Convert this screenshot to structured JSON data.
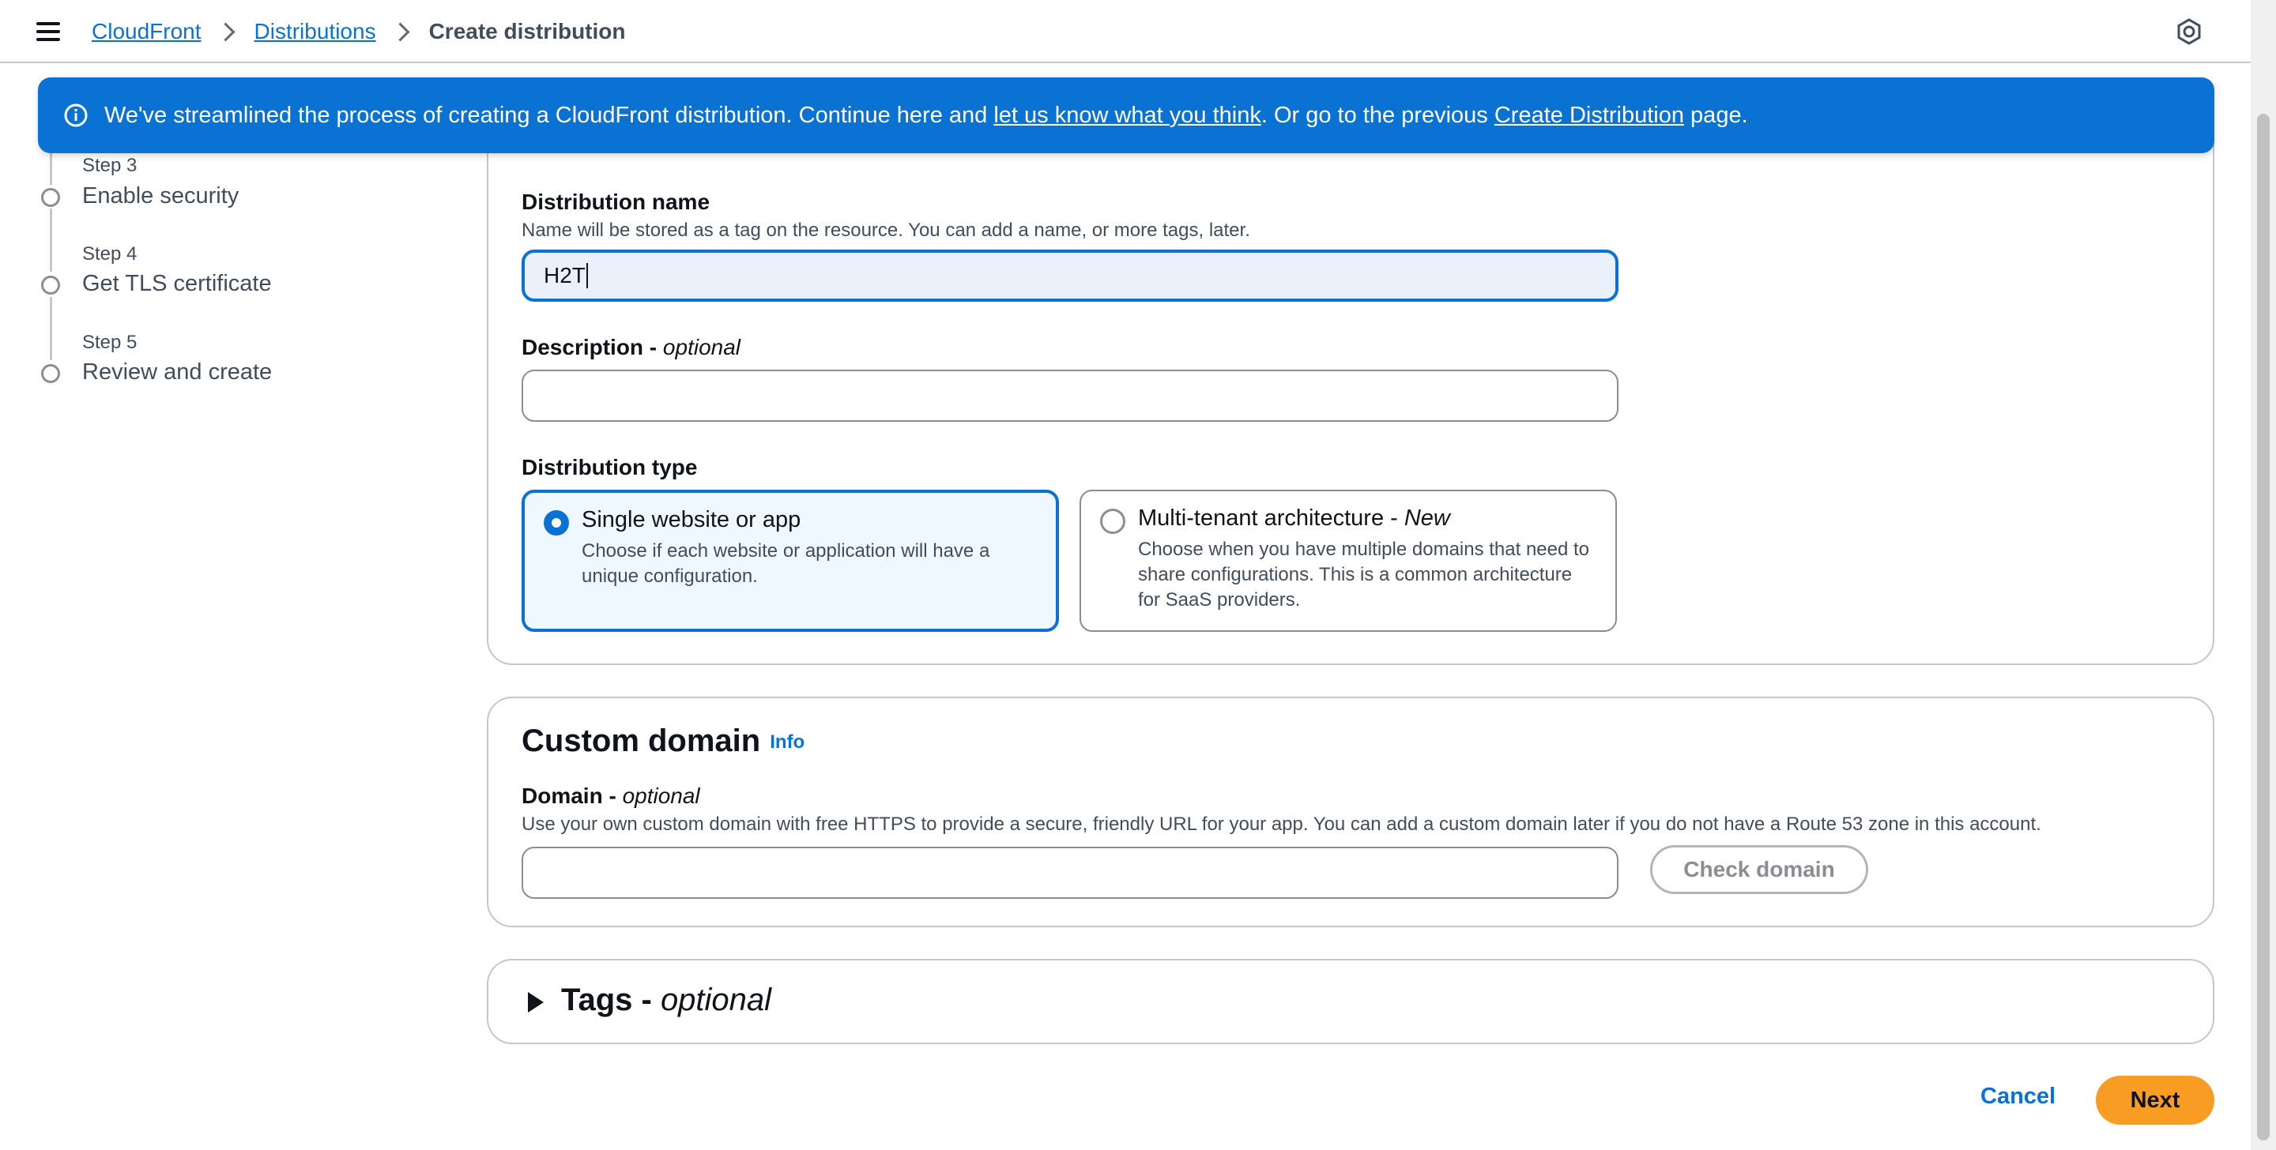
{
  "breadcrumb": {
    "home": "CloudFront",
    "distributions": "Distributions",
    "current": "Create distribution"
  },
  "banner": {
    "text1": "We've streamlined the process of creating a CloudFront distribution. Continue here and ",
    "link1": "let us know what you think",
    "text2": ". Or go to the previous ",
    "link2": "Create Distribution",
    "text3": " page."
  },
  "steps": [
    {
      "num": "Step 3",
      "label": "Enable security"
    },
    {
      "num": "Step 4",
      "label": "Get TLS certificate"
    },
    {
      "num": "Step 5",
      "label": "Review and create"
    }
  ],
  "distribution_options": {
    "name_label": "Distribution name",
    "name_desc": "Name will be stored as a tag on the resource. You can add a name, or more tags, later.",
    "name_value": "H2T",
    "description_label": "Description - ",
    "description_optional": "optional",
    "description_value": "",
    "type_label": "Distribution type",
    "single": {
      "title": "Single website or app",
      "desc": "Choose if each website or application will have a unique configuration.",
      "selected": true
    },
    "multi": {
      "title": "Multi-tenant architecture - ",
      "badge": "New",
      "desc": "Choose when you have multiple domains that need to share configurations. This is a common architecture for SaaS providers.",
      "selected": false
    }
  },
  "custom_domain": {
    "title": "Custom domain",
    "info": "Info",
    "domain_label": "Domain - ",
    "domain_optional": "optional",
    "domain_desc": "Use your own custom domain with free HTTPS to provide a secure, friendly URL for your app. You can add a custom domain later if you do not have a Route 53 zone in this account.",
    "domain_value": "",
    "check_button": "Check domain"
  },
  "tags": {
    "title": "Tags - ",
    "optional": "optional"
  },
  "footer": {
    "cancel": "Cancel",
    "next": "Next"
  },
  "colors": {
    "primary": "#0972d3",
    "next_button": "#f89c24",
    "banner": "#0972d3"
  }
}
